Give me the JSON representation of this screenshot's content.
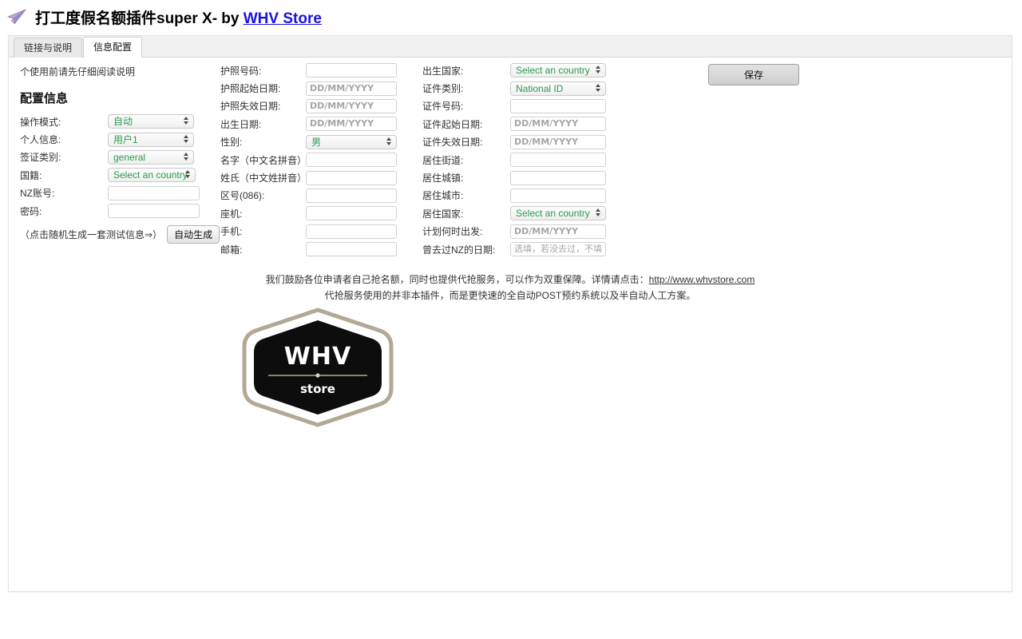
{
  "header": {
    "icon": "paper-plane-icon",
    "title_main": "打工度假名额插件super X- by ",
    "link_label": "WHV Store",
    "link_color": "#1a12e0"
  },
  "tabs": [
    {
      "label": "链接与说明",
      "active": false
    },
    {
      "label": "信息配置",
      "active": true
    }
  ],
  "content": {
    "intro_note": "个使用前请先仔细阅读说明",
    "section_title": "配置信息",
    "save_label": "保存",
    "generate_note": "（点击随机生成一套测试信息⇒）",
    "generate_label": "自动生成"
  },
  "left_column": [
    {
      "label": "操作模式:",
      "type": "select",
      "value": "自动",
      "width": "w-left-sel"
    },
    {
      "label": "个人信息:",
      "type": "select",
      "value": "用户1",
      "width": "w-left-sel"
    },
    {
      "label": "签证类别:",
      "type": "select",
      "value": "general",
      "width": "w-left-sel"
    },
    {
      "label": "国籍:",
      "type": "select",
      "value": "Select an country",
      "width": "w-left-sel2"
    },
    {
      "label": "NZ账号:",
      "type": "text",
      "value": "",
      "placeholder": "",
      "width": "w-left-txt"
    },
    {
      "label": "密码:",
      "type": "text",
      "value": "",
      "placeholder": "",
      "width": "w-left-txt"
    }
  ],
  "middle_column": [
    {
      "label": "护照号码:",
      "type": "text",
      "value": "",
      "placeholder": ""
    },
    {
      "label": "护照起始日期:",
      "type": "text",
      "value": "",
      "placeholder": "DD/MM/YYYY"
    },
    {
      "label": "护照失效日期:",
      "type": "text",
      "value": "",
      "placeholder": "DD/MM/YYYY"
    },
    {
      "label": "出生日期:",
      "type": "text",
      "value": "",
      "placeholder": "DD/MM/YYYY"
    },
    {
      "label": "性别:",
      "type": "select",
      "value": "男"
    },
    {
      "label": "名字（中文名拼音）:",
      "type": "text",
      "value": "",
      "placeholder": ""
    },
    {
      "label": "姓氏（中文姓拼音）:",
      "type": "text",
      "value": "",
      "placeholder": ""
    },
    {
      "label": "区号(086):",
      "type": "text",
      "value": "",
      "placeholder": ""
    },
    {
      "label": "座机:",
      "type": "text",
      "value": "",
      "placeholder": ""
    },
    {
      "label": "手机:",
      "type": "text",
      "value": "",
      "placeholder": ""
    },
    {
      "label": "邮箱:",
      "type": "text",
      "value": "",
      "placeholder": ""
    }
  ],
  "right_column": [
    {
      "label": "出生国家:",
      "type": "select",
      "value": "Select an country"
    },
    {
      "label": "证件类别:",
      "type": "select",
      "value": "National ID"
    },
    {
      "label": "证件号码:",
      "type": "text",
      "value": "",
      "placeholder": ""
    },
    {
      "label": "证件起始日期:",
      "type": "text",
      "value": "",
      "placeholder": "DD/MM/YYYY"
    },
    {
      "label": "证件失效日期:",
      "type": "text",
      "value": "",
      "placeholder": "DD/MM/YYYY"
    },
    {
      "label": "居住街道:",
      "type": "text",
      "value": "",
      "placeholder": ""
    },
    {
      "label": "居住城镇:",
      "type": "text",
      "value": "",
      "placeholder": ""
    },
    {
      "label": "居住城市:",
      "type": "text",
      "value": "",
      "placeholder": ""
    },
    {
      "label": "居住国家:",
      "type": "select",
      "value": "Select an country"
    },
    {
      "label": "计划何时出发:",
      "type": "text",
      "value": "",
      "placeholder": "DD/MM/YYYY"
    },
    {
      "label": "曾去过NZ的日期:",
      "type": "text",
      "value": "",
      "placeholder": "选填，若没去过，不填",
      "cn_placeholder": true
    }
  ],
  "promo": {
    "line1_a": "我们鼓励各位申请者自己抢名额，同时也提供代抢服务，可以作为双重保障。详情请点击：",
    "line1_link": "http://www.whvstore.com",
    "line2": "代抢服务使用的并非本插件，而是更快速的全自动POST预约系统以及半自动人工方案。"
  },
  "logo": {
    "name": "whv-store-logo",
    "primary_text": "WHV",
    "secondary_text": "store",
    "badge_color": "#0d0d0d",
    "ring_color": "#b3a893"
  }
}
